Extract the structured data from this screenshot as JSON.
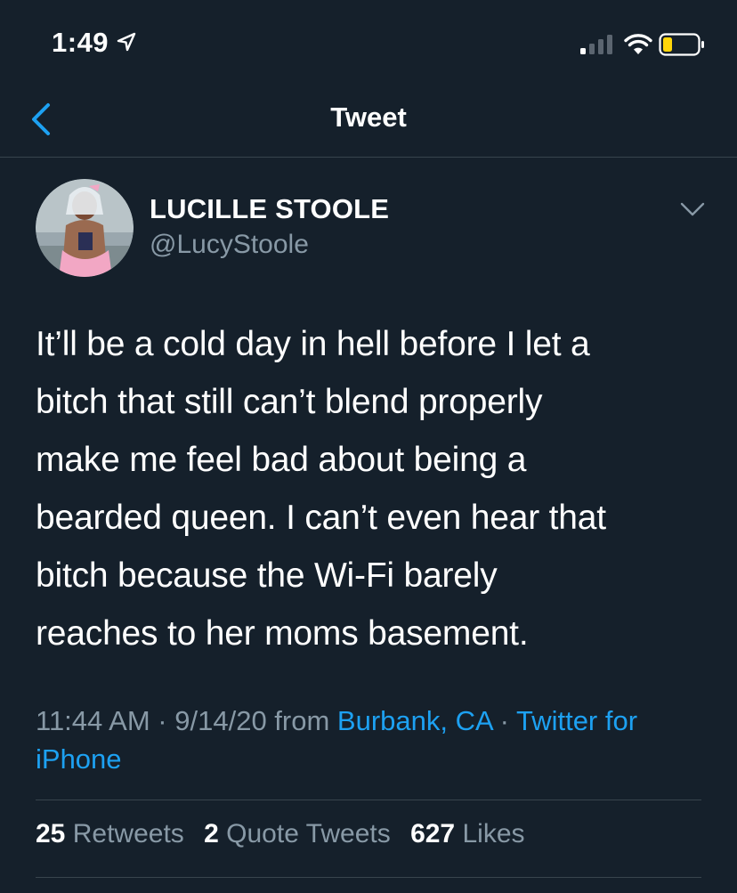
{
  "status_bar": {
    "time": "1:49",
    "icons": [
      "location-arrow-icon",
      "signal-bars-icon",
      "wifi-icon",
      "battery-low-icon"
    ]
  },
  "nav": {
    "back_icon": "chevron-left-icon",
    "title": "Tweet"
  },
  "tweet": {
    "author": {
      "display_name": "LUCILLE STOOLE",
      "handle": "@LucyStoole"
    },
    "text": "It’ll be a cold day in hell before I let a\nbitch that still can’t blend properly\nmake me feel bad about being a\nbearded queen. I can’t even hear that\nbitch because the Wi-Fi barely\nreaches to her moms basement.",
    "time": "11:44 AM",
    "separator": " · ",
    "date": "9/14/20",
    "from_word": " from ",
    "location": "Burbank, CA",
    "source": "Twitter for iPhone"
  },
  "stats": {
    "retweets_count": "25",
    "retweets_label": "Retweets",
    "quotes_count": "2",
    "quotes_label": "Quote Tweets",
    "likes_count": "627",
    "likes_label": "Likes"
  },
  "colors": {
    "background": "#15202b",
    "accent": "#1da1f2",
    "secondary_text": "#8899a6",
    "divider": "#38444d",
    "battery_low": "#ffd60a"
  }
}
